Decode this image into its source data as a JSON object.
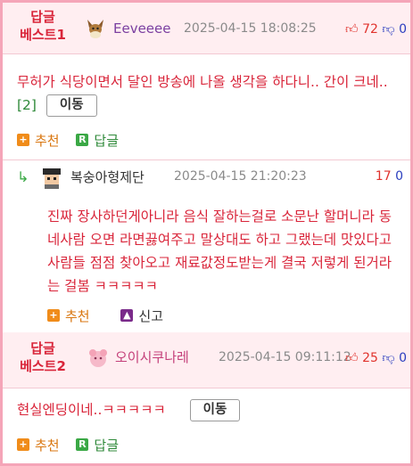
{
  "comments": [
    {
      "best_label_1": "답글",
      "best_label_2": "베스트1",
      "nickname": "Eeveeee",
      "date": "2025-04-15 18:08:25",
      "up": "72",
      "down": "0",
      "text": "무허가 식당이면서 달인 방송에 나올 생각을 하다니.. 간이 크네..",
      "reply_count": "[2]",
      "move_label": "이동",
      "recommend_label": "추천",
      "reply_label": "답글"
    },
    {
      "best_label_1": "답글",
      "best_label_2": "베스트2",
      "nickname": "오이시쿠나레",
      "date": "2025-04-15 09:11:12",
      "up": "25",
      "down": "0",
      "text": "현실엔딩이네..ㅋㅋㅋㅋㅋ",
      "move_label": "이동",
      "recommend_label": "추천",
      "reply_label": "답글"
    }
  ],
  "reply": {
    "nickname": "복숭아형제단",
    "date": "2025-04-15 21:20:23",
    "up": "17",
    "down": "0",
    "text": "진짜 장사하던게아니라 음식 잘하는걸로 소문난 할머니라 동네사람 오면 라면끓여주고 말상대도 하고 그랬는데 맛있다고 사람들 점점 찾아오고 재료값정도받는게 결국 저렇게 된거라는 걸봄 ㅋㅋㅋㅋㅋ",
    "recommend_label": "추천",
    "report_label": "신고"
  },
  "icons": {
    "thumb_up": "thumb-up-icon",
    "thumb_down": "thumb-down-icon",
    "recommend": "plus-icon",
    "reply": "r-icon",
    "report": "warning-icon",
    "reply_arrow": "reply-arrow-icon"
  },
  "colors": {
    "border": "#f5a5b8",
    "header_bg": "#ffeef1",
    "best_red": "#d9253a",
    "nick_purple": "#7b3fa0"
  }
}
